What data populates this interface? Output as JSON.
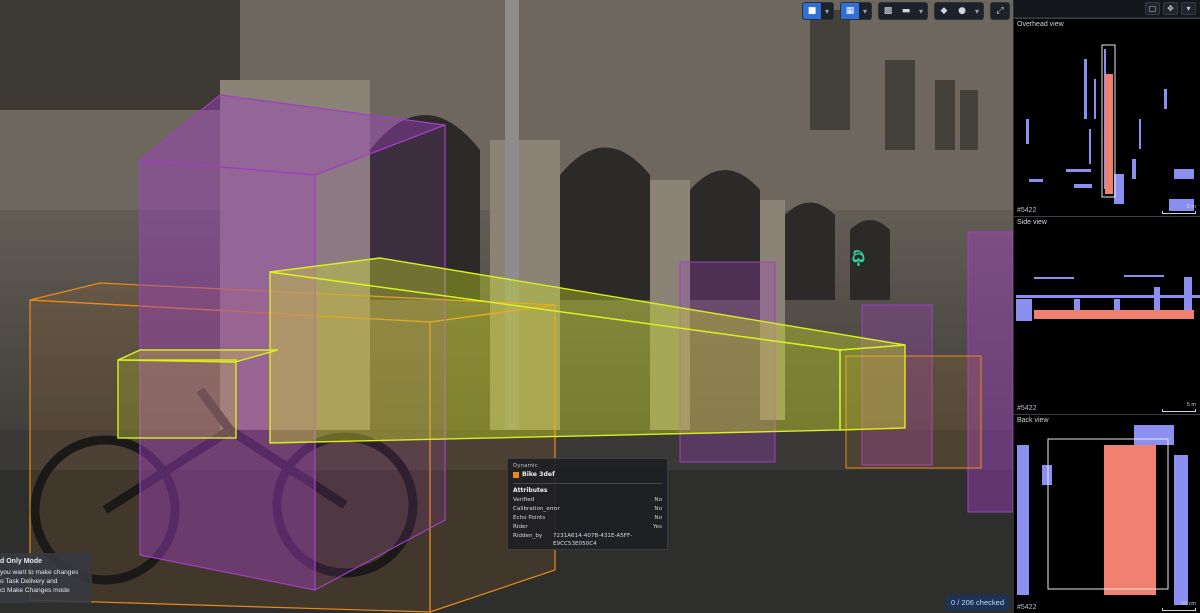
{
  "toolbar": {
    "groups": [
      {
        "name": "camera",
        "icons": [
          "video-camera-icon",
          "chevron-down-icon"
        ]
      },
      {
        "name": "layout",
        "icons": [
          "grid-layout-icon",
          "chevron-down-icon"
        ]
      },
      {
        "name": "tools",
        "icons": [
          "pattern-icon",
          "video-icon",
          "chevron-down-icon"
        ]
      },
      {
        "name": "display",
        "icons": [
          "layers-icon",
          "circle-icon",
          "chevron-down-icon"
        ]
      },
      {
        "name": "fullscreen",
        "icons": [
          "expand-icon"
        ]
      }
    ],
    "accent": "#2f6fd8"
  },
  "tooltip": {
    "kind": "Dynamic",
    "object_name": "Bike 3def",
    "object_color": "#e88a1a",
    "attributes_title": "Attributes",
    "attributes": [
      {
        "key": "Verified",
        "value": "No"
      },
      {
        "key": "Calibration_error",
        "value": "No"
      },
      {
        "key": "Echo Points",
        "value": "No"
      },
      {
        "key": "Rider",
        "value": "Yes"
      }
    ],
    "ridden_by_key": "Ridden_by",
    "ridden_by_line1": "7231A614-407B-431E-A5FF-",
    "ridden_by_line2": "E9CC53E050C4"
  },
  "readonly": {
    "title": "d Only Mode",
    "line1": "you want to make changes",
    "line2": "o Task Delivery and",
    "line3": "ct Make Changes mode"
  },
  "status": {
    "checked": "0 / 206 checked"
  },
  "panel": {
    "views": [
      {
        "label": "Overhead view",
        "id": "5422",
        "scale": "5 m"
      },
      {
        "label": "Side view",
        "id": "5422",
        "scale": "5 m"
      },
      {
        "label": "Back view",
        "id": "5422",
        "scale": "50 cm"
      }
    ]
  },
  "colors": {
    "pedestrian_box": "#a040c0",
    "bike_box": "#e88a1a",
    "selected_box": "#d8f020",
    "point_cloud": "#8a8ff0",
    "selected_points": "#f08070"
  }
}
